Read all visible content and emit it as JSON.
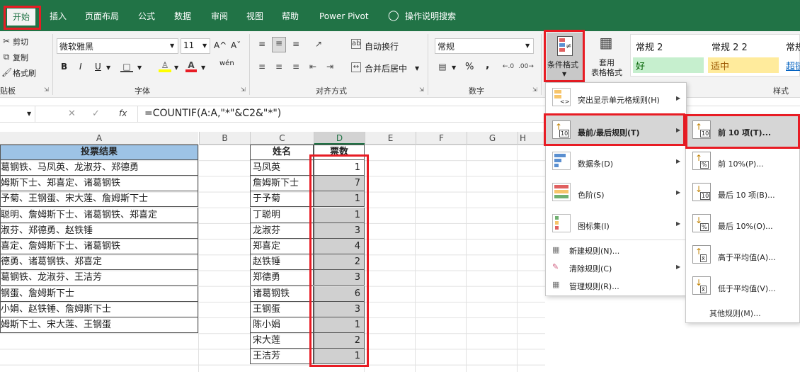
{
  "ribbon_tabs": [
    "开始",
    "插入",
    "页面布局",
    "公式",
    "数据",
    "审阅",
    "视图",
    "帮助",
    "Power Pivot",
    "操作说明搜索"
  ],
  "clipboard": {
    "cut": "剪切",
    "copy": "复制",
    "format_painter": "格式刷",
    "group": "剪贴板"
  },
  "font": {
    "name": "微软雅黑",
    "size": "11",
    "group": "字体",
    "bold": "B",
    "italic": "I",
    "underline": "U",
    "grow": "A^",
    "shrink": "Aˇ",
    "wen": "wén"
  },
  "align": {
    "wrap": "自动换行",
    "merge": "合并后居中",
    "group": "对齐方式"
  },
  "number": {
    "format": "常规",
    "group": "数字",
    "percent": "%",
    "comma": ","
  },
  "cf_button": "条件格式",
  "table_format": "套用\n表格格式",
  "styles": {
    "s1": "常规 2",
    "s2": "常规 2 2",
    "s3": "常规",
    "good": "好",
    "neutral": "适中",
    "link": "超链",
    "group": "样式"
  },
  "formula_bar": {
    "fx": "fx",
    "formula": "=COUNTIF(A:A,\"*\"&C2&\"*\")"
  },
  "columns": [
    "A",
    "B",
    "C",
    "D",
    "E",
    "F",
    "G",
    "H"
  ],
  "table_a": {
    "header": "投票结果",
    "rows": [
      "葛钢铁、马凤英、龙淑芬、郑德勇",
      "姆斯下士、郑喜定、诸葛钢铁",
      "予菊、王钢蛋、宋大莲、詹姆斯下士",
      "聪明、詹姆斯下士、诸葛钢铁、郑喜定",
      "淑芬、郑德勇、赵铁锤",
      "喜定、詹姆斯下士、诸葛钢铁",
      "德勇、诸葛钢铁、郑喜定",
      "葛钢铁、龙淑芬、王洁芳",
      "钢蛋、詹姆斯下士",
      "小娟、赵铁锤、詹姆斯下士",
      "姆斯下士、宋大莲、王钢蛋"
    ]
  },
  "table_cd": {
    "h_name": "姓名",
    "h_votes": "票数",
    "rows": [
      [
        "马凤英",
        "1"
      ],
      [
        "詹姆斯下士",
        "7"
      ],
      [
        "于予菊",
        "1"
      ],
      [
        "丁聪明",
        "1"
      ],
      [
        "龙淑芬",
        "3"
      ],
      [
        "郑喜定",
        "4"
      ],
      [
        "赵铁锤",
        "2"
      ],
      [
        "郑德勇",
        "3"
      ],
      [
        "诸葛钢铁",
        "6"
      ],
      [
        "王钢蛋",
        "3"
      ],
      [
        "陈小娟",
        "1"
      ],
      [
        "宋大莲",
        "2"
      ],
      [
        "王洁芳",
        "1"
      ]
    ]
  },
  "cf_menu": {
    "highlight": "突出显示单元格规则(H)",
    "topbottom": "最前/最后规则(T)",
    "databar": "数据条(D)",
    "colorscale": "色阶(S)",
    "iconset": "图标集(I)",
    "newrule": "新建规则(N)...",
    "clear": "清除规则(C)",
    "manage": "管理规则(R)..."
  },
  "sub_menu": {
    "top10": "前 10 项(T)...",
    "top10pct": "前 10%(P)...",
    "bottom10": "最后 10 项(B)...",
    "bottom10pct": "最后 10%(O)...",
    "above": "高于平均值(A)...",
    "below": "低于平均值(V)...",
    "more": "其他规则(M)...",
    "icon10": "10",
    "iconpct": "%",
    "iconavg": "x̄"
  },
  "colors": {
    "ribbon": "#217346",
    "highlight_red": "#e81c24",
    "header_blue": "#9dc3e6",
    "selected_gray": "#d0d0d0",
    "good_fill": "#c6efce",
    "neutral_fill": "#ffeb9c"
  }
}
